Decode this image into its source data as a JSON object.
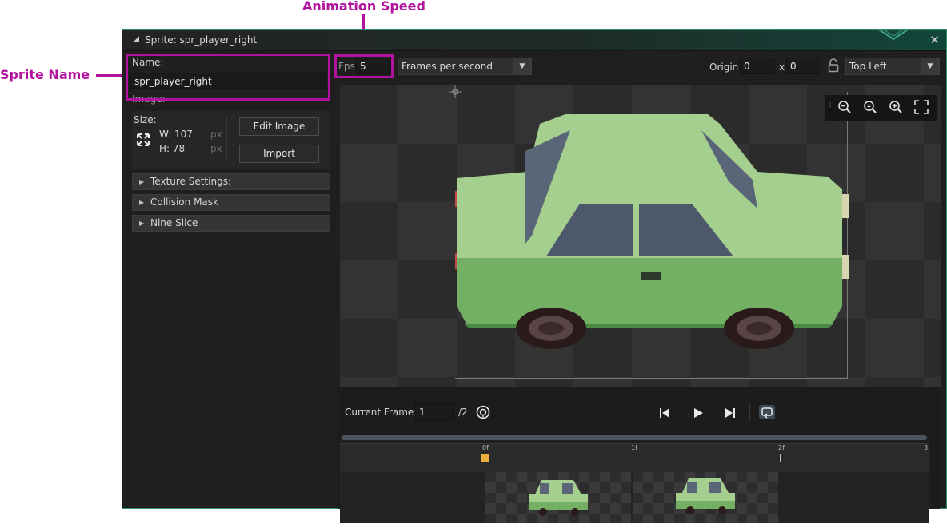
{
  "annotations": {
    "animation_speed": "Animation Speed",
    "sprite_name": "Sprite Name"
  },
  "window": {
    "title": "Sprite: spr_player_right",
    "close_glyph": "✕"
  },
  "left_panel": {
    "name_label": "Name:",
    "name_value": "spr_player_right",
    "image_label": "Image:",
    "size_label": "Size:",
    "width": "W: 107",
    "height": "H: 78",
    "unit": "px",
    "edit_image_button": "Edit Image",
    "import_button": "Import",
    "sections": [
      "Texture Settings:",
      "Collision Mask",
      "Nine Slice"
    ]
  },
  "toolbar": {
    "fps_label": "Fps",
    "fps_value": "5",
    "speed_mode": "Frames per second",
    "origin_label": "Origin",
    "origin_x": "0",
    "origin_sep": "x",
    "origin_y": "0",
    "origin_preset": "Top Left"
  },
  "playback": {
    "current_frame_label": "Current Frame:",
    "current_frame_value": "1",
    "total_frames": "/2"
  },
  "timeline": {
    "ticks": [
      "0f",
      "1f",
      "2f",
      "3"
    ]
  },
  "colors": {
    "annotation": "#b3129f",
    "window_border": "#2e8e6d",
    "playhead": "#f0b040",
    "car_body": "#a5cf8f"
  },
  "icons": {
    "resize": "expand-icon",
    "zoom_out": "zoom-out-icon",
    "zoom_reset": "zoom-reset-icon",
    "zoom_in": "zoom-in-icon",
    "fit": "fit-screen-icon",
    "lock": "lock-icon"
  }
}
